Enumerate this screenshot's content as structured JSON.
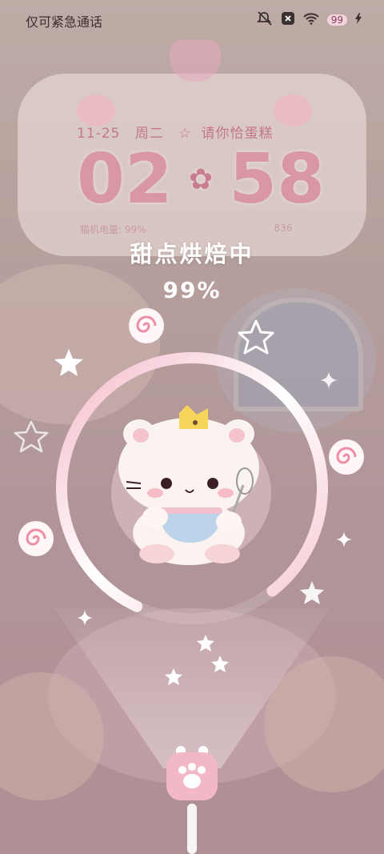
{
  "status_bar": {
    "carrier_text": "仅可紧急通话",
    "battery_level": "99"
  },
  "widget": {
    "date": "11-25",
    "weekday": "周二",
    "slogan": "请你恰蛋糕",
    "hour": "02",
    "minute": "58",
    "battery_label": "猫机电量",
    "battery_value": "99%",
    "steps_value": "836"
  },
  "charging": {
    "title": "甜点烘焙中",
    "percent": "99%",
    "progress": 0.99
  },
  "colors": {
    "accent_pink": "#f0b8c8",
    "ring_white": "#ffffff",
    "clock_pink": "#d997a6"
  },
  "icons": {
    "status": [
      "mute-icon",
      "sim-off-icon",
      "wifi-icon",
      "battery-icon",
      "charging-bolt-icon"
    ],
    "decor": [
      "star-icon",
      "swirl-candy-icon",
      "sparkle-icon",
      "paw-icon"
    ]
  }
}
